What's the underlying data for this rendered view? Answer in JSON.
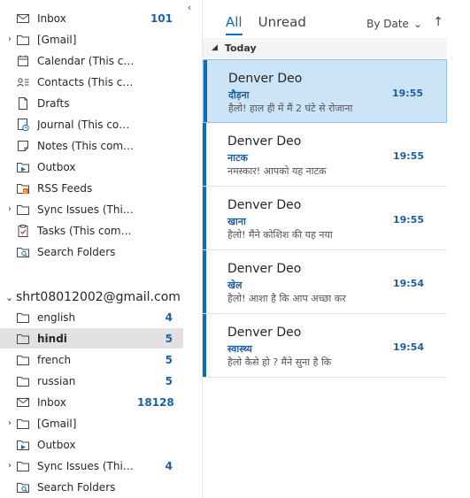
{
  "folders_top": [
    {
      "label": "Inbox",
      "icon": "inbox-icon",
      "count": "101",
      "chevron": false
    },
    {
      "label": "[Gmail]",
      "icon": "folder-icon",
      "count": "",
      "chevron": true
    },
    {
      "label": "Calendar (This computer...",
      "icon": "calendar-icon",
      "count": "",
      "chevron": false
    },
    {
      "label": "Contacts (This computer...",
      "icon": "contacts-icon",
      "count": "",
      "chevron": false
    },
    {
      "label": "Drafts",
      "icon": "drafts-icon",
      "count": "",
      "chevron": false
    },
    {
      "label": "Journal (This computer on...",
      "icon": "journal-icon",
      "count": "",
      "chevron": false
    },
    {
      "label": "Notes (This computer only)",
      "icon": "notes-icon",
      "count": "",
      "chevron": false
    },
    {
      "label": "Outbox",
      "icon": "outbox-icon",
      "count": "",
      "chevron": false
    },
    {
      "label": "RSS Feeds",
      "icon": "rss-icon",
      "count": "",
      "chevron": false
    },
    {
      "label": "Sync Issues (This compute...",
      "icon": "sync-issues-icon",
      "count": "",
      "chevron": true
    },
    {
      "label": "Tasks (This computer only)",
      "icon": "tasks-icon",
      "count": "",
      "chevron": false
    },
    {
      "label": "Search Folders",
      "icon": "search-folder-icon",
      "count": "",
      "chevron": false
    }
  ],
  "account": {
    "label": "shrt08012002@gmail.com"
  },
  "folders_account": [
    {
      "label": "english",
      "icon": "folder-icon",
      "count": "4",
      "chevron": false,
      "selected": false
    },
    {
      "label": "hindi",
      "icon": "folder-icon",
      "count": "5",
      "chevron": false,
      "selected": true
    },
    {
      "label": "french",
      "icon": "folder-icon",
      "count": "5",
      "chevron": false,
      "selected": false
    },
    {
      "label": "russian",
      "icon": "folder-icon",
      "count": "5",
      "chevron": false,
      "selected": false
    },
    {
      "label": "Inbox",
      "icon": "inbox-icon",
      "count": "18128",
      "chevron": false,
      "selected": false
    },
    {
      "label": "[Gmail]",
      "icon": "folder-icon",
      "count": "",
      "chevron": true,
      "selected": false
    },
    {
      "label": "Outbox",
      "icon": "outbox-icon",
      "count": "",
      "chevron": false,
      "selected": false
    },
    {
      "label": "Sync Issues (This comp...",
      "icon": "sync-issues-icon",
      "count": "4",
      "chevron": true,
      "selected": false
    },
    {
      "label": "Search Folders",
      "icon": "search-folder-icon",
      "count": "",
      "chevron": false,
      "selected": false
    }
  ],
  "list": {
    "tab_all": "All",
    "tab_unread": "Unread",
    "sort_label": "By Date",
    "group_label": "Today"
  },
  "messages": [
    {
      "sender": "Denver Deo",
      "subject": "दौड़ना",
      "preview": "हैलो! हाल ही में मैं 2 घंटे से रोजाना",
      "time": "19:55",
      "selected": true
    },
    {
      "sender": "Denver Deo",
      "subject": "नाटक",
      "preview": "नमस्कार! आपको यह नाटक",
      "time": "19:55",
      "selected": false
    },
    {
      "sender": "Denver Deo",
      "subject": "खाना",
      "preview": "हैलो! मैंने कोशिश की यह नया",
      "time": "19:55",
      "selected": false
    },
    {
      "sender": "Denver Deo",
      "subject": "खेल",
      "preview": "हैलो! आशा है कि आप अच्छा कर",
      "time": "19:54",
      "selected": false
    },
    {
      "sender": "Denver Deo",
      "subject": "स्वास्थ्य",
      "preview": "हैलो कैसे हो ? मैंने सुना है कि",
      "time": "19:54",
      "selected": false
    }
  ],
  "colors": {
    "accent": "#0f6cbd",
    "count": "#1f5f9f",
    "selected_bg": "#cce4f7",
    "selected_folder": "#e1e1e1"
  }
}
